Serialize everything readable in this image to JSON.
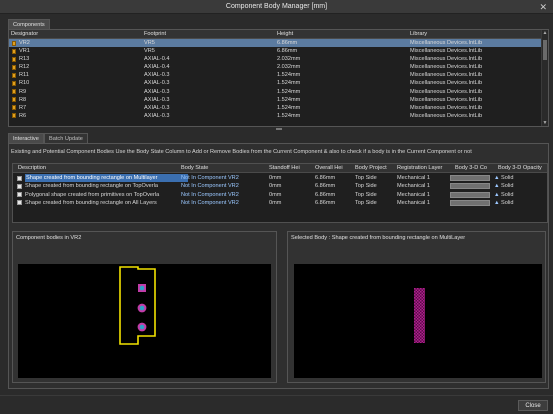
{
  "window": {
    "title": "Component Body Manager [mm]",
    "close_glyph": "✕"
  },
  "top_tab": "Components",
  "components": {
    "columns": [
      "Designator",
      "Footprint",
      "Height",
      "Library"
    ],
    "rows": [
      {
        "designator": "VR2",
        "footprint": "VR5",
        "height": "6.86mm",
        "library": "Miscellaneous Devices.IntLib"
      },
      {
        "designator": "VR1",
        "footprint": "VR5",
        "height": "6.86mm",
        "library": "Miscellaneous Devices.IntLib"
      },
      {
        "designator": "R13",
        "footprint": "AXIAL-0.4",
        "height": "2.032mm",
        "library": "Miscellaneous Devices.IntLib"
      },
      {
        "designator": "R12",
        "footprint": "AXIAL-0.4",
        "height": "2.032mm",
        "library": "Miscellaneous Devices.IntLib"
      },
      {
        "designator": "R11",
        "footprint": "AXIAL-0.3",
        "height": "1.524mm",
        "library": "Miscellaneous Devices.IntLib"
      },
      {
        "designator": "R10",
        "footprint": "AXIAL-0.3",
        "height": "1.524mm",
        "library": "Miscellaneous Devices.IntLib"
      },
      {
        "designator": "R9",
        "footprint": "AXIAL-0.3",
        "height": "1.524mm",
        "library": "Miscellaneous Devices.IntLib"
      },
      {
        "designator": "R8",
        "footprint": "AXIAL-0.3",
        "height": "1.524mm",
        "library": "Miscellaneous Devices.IntLib"
      },
      {
        "designator": "R7",
        "footprint": "AXIAL-0.3",
        "height": "1.524mm",
        "library": "Miscellaneous Devices.IntLib"
      },
      {
        "designator": "R6",
        "footprint": "AXIAL-0.3",
        "height": "1.524mm",
        "library": "Miscellaneous Devices.IntLib"
      }
    ]
  },
  "lower_tabs": [
    "Interactive",
    "Batch Update"
  ],
  "instructions": "Existing and Potential Component Bodies   Use the Body State Column to Add or Remove Bodies from the Current Component & also to check if a body is in the Current Component or not",
  "bodies": {
    "columns": [
      "Description",
      "Body State",
      "Standoff Hei",
      "Overall Hei",
      "Body Project",
      "Registration Layer",
      "Body 3-D Co",
      "Body 3-D Opacity"
    ],
    "rows": [
      {
        "description": "Shape created from bounding rectangle on Multilayer",
        "state": "Not In Component VR2",
        "standoff": "0mm",
        "overall": "6.86mm",
        "projection": "Top Side",
        "layer": "Mechanical 1",
        "opacity": "Solid"
      },
      {
        "description": "Shape created from bounding rectangle on TopOverla",
        "state": "Not In Component VR2",
        "standoff": "0mm",
        "overall": "6.86mm",
        "projection": "Top Side",
        "layer": "Mechanical 1",
        "opacity": "Solid"
      },
      {
        "description": "Polygonal shape created from primitives on TopOverla",
        "state": "Not In Component VR2",
        "standoff": "0mm",
        "overall": "6.86mm",
        "projection": "Top Side",
        "layer": "Mechanical 1",
        "opacity": "Solid"
      },
      {
        "description": "Shape created from bounding rectangle on All Layers",
        "state": "Not In Component VR2",
        "standoff": "0mm",
        "overall": "6.86mm",
        "projection": "Top Side",
        "layer": "Mechanical 1",
        "opacity": "Solid"
      }
    ]
  },
  "left_view": {
    "caption": "Component bodies in VR2"
  },
  "right_view": {
    "caption": "Selected Body : Shape created from bounding rectangle on MultiLayer"
  },
  "buttons": {
    "close": "Close"
  },
  "colors": {
    "selection": "#5b7ba0",
    "outline": "#f2e200",
    "pad_ring": "#c23ca8",
    "pad_center": "#2fa3c8",
    "body_fill": "#b0208e"
  }
}
